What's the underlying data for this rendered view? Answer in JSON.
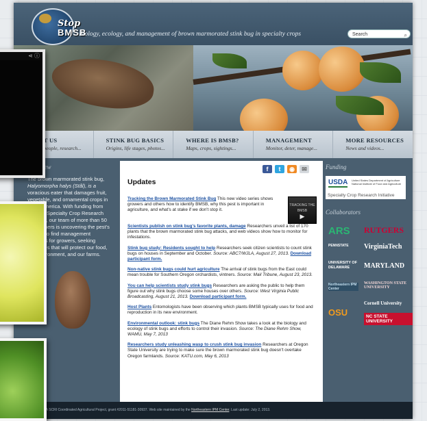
{
  "site": {
    "logo_line1": "Stop",
    "logo_line2": "BMSB",
    "tagline": "Biology, ecology, and management of brown marmorated stink bug in specialty crops"
  },
  "search": {
    "placeholder": "Search",
    "icon": "search-icon"
  },
  "nav": [
    {
      "title": "ABOUT US",
      "sub": "Project, people, research..."
    },
    {
      "title": "STINK BUG BASICS",
      "sub": "Origins, life stages, photos..."
    },
    {
      "title": "WHERE IS BMSB?",
      "sub": "Maps, crops, sightings..."
    },
    {
      "title": "MANAGEMENT",
      "sub": "Monitor, deter, manage..."
    },
    {
      "title": "MORE RESOURCES",
      "sub": "News and videos..."
    }
  ],
  "overview": {
    "header": "Overview",
    "p1": "The brown marmorated stink bug,",
    "p2": "Halyomorpha halys (Stål), is a",
    "p3": "voracious eater that damages fruit,",
    "p4": "vegetable, and ornamental crops in",
    "p5": "North America. With funding from",
    "p6": "USDA's Specialty Crop Research",
    "p7": "Initiative, our team of more than 50",
    "p8": "researchers is uncovering the pest's",
    "p9": "biology to find management",
    "p10": "solutions for growers, seeking",
    "p11": "strategies that will protect our food,",
    "p12": "our environment, and our farms."
  },
  "social": [
    "facebook-icon",
    "twitter-icon",
    "rss-icon",
    "email-icon"
  ],
  "updates": {
    "title": "Updates",
    "video_label": "TRACKING THE BMSB",
    "entries": [
      {
        "link": "Tracking the Brown Marmorated Stink Bug",
        "text": " This new video series shows growers and others how to identify BMSB, why this pest is important in agriculture, and what's at stake if we don't stop it."
      },
      {
        "link": "Scientists publish on stink bug's favorite plants, damage",
        "text": "  Researchers unveil a list of 170 plants that the brown marmorated stink bug attacks, and web videos show how to monitor for infestations."
      },
      {
        "link": "Stink bug study: Residents sought to help",
        "text": " Researchers seek citizen scientists to count stink bugs on houses in September and October. ",
        "src": "Source: ABC7/WJLA, August 27, 2013.",
        "dl": "Download participant form."
      },
      {
        "link": "Non-native stink bugs could hurt agriculture",
        "text": " The arrival of stink bugs from the East could mean trouble for Southern Oregon orchardists, vintners. ",
        "src": "Source: Mail Tribune, August 23, 2013."
      },
      {
        "link": "You can help scientists study stink bugs",
        "text": " Researchers are asking the public to help them figure out why stink bugs choose some houses over others. ",
        "src": "Source: West Virginia Public Broadcasting, August 21, 2013.",
        "dl": "Download participant form."
      },
      {
        "link": "Host Plants",
        "text": " Entomologists have been observing which plants BMSB typically uses for food and reproduction in its new environment."
      },
      {
        "link": "Environmental outlook: stink bugs",
        "text": " The Diane Rehm Show takes a look at the biology and ecology of stink bugs and efforts to control their invasion. ",
        "src": "Source: The Diane Rehm Show, WAMU, May 7, 2013"
      },
      {
        "link": "Researchers study unleashing wasp to crush stink bug invasion",
        "text": " Researchers at Oregon State University are trying to make sure the brown marmorated stink bug doesn't overtake Oregon farmlands. ",
        "src": "Source: KATU.com, May 6, 2013"
      }
    ]
  },
  "sidebar": {
    "funding_header": "Funding",
    "usda": "USDA",
    "usda_small": "United States Department of Agriculture  National Institute of Food and Agriculture",
    "scri": "Specialty Crop Research Initiative",
    "collab_header": "Collaborators",
    "logos": [
      "ARS",
      "RUTGERS",
      "PENNSTATE",
      "VirginiaTech",
      "UNIVERSITY OF DELAWARE",
      "MARYLAND",
      "Northeastern IPM Center",
      "WASHINGTON STATE UNIVERSITY",
      "OSU",
      "Cornell University",
      "NC STATE UNIVERSITY"
    ]
  },
  "footer": {
    "text": "...HPA SCRI Coordinated Agricultural Project, grant #2011-51181-30937. Web site maintained by the ",
    "link": "Northeastern IPM Center",
    "end": ". Last update: July 2, 2013."
  },
  "colors": {
    "header": "#4b6479",
    "content_bg": "#4a5f70",
    "link": "#1a4fa0",
    "ncstate_red": "#c8102e",
    "rutgers_red": "#cc0033"
  }
}
